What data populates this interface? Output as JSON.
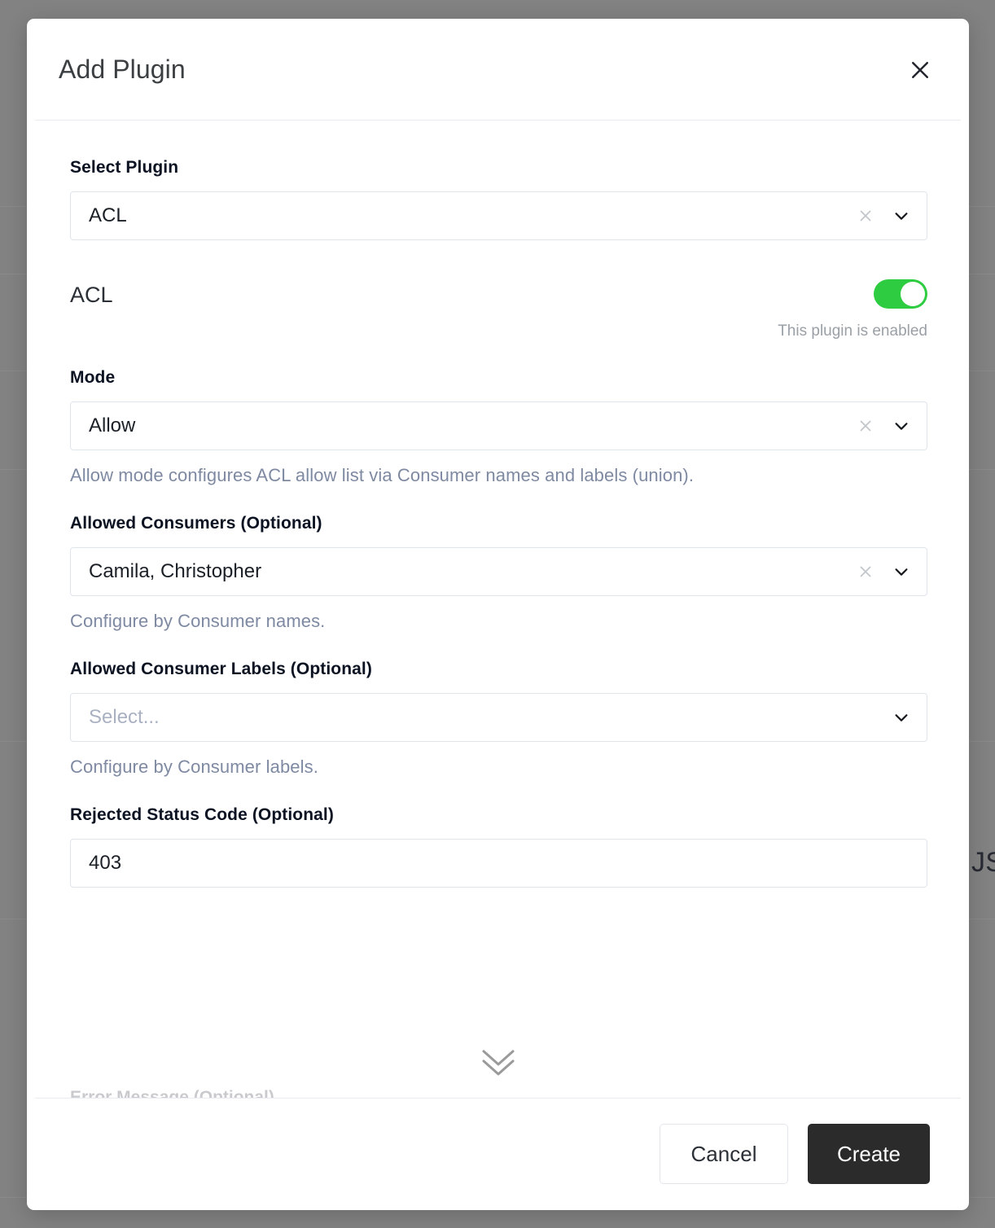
{
  "background": {
    "visible_text": "JS",
    "overlay_color": "#828282"
  },
  "modal": {
    "title": "Add Plugin",
    "close_icon": "close-icon",
    "fields": {
      "select_plugin": {
        "label": "Select Plugin",
        "value": "ACL",
        "clear_icon": "clear-x-icon",
        "chevron_icon": "chevron-down-icon"
      },
      "plugin_toggle": {
        "name": "ACL",
        "enabled": true,
        "caption": "This plugin is enabled",
        "on_color": "#2ecc40"
      },
      "mode": {
        "label": "Mode",
        "value": "Allow",
        "help": "Allow mode configures ACL allow list via Consumer names and labels (union).",
        "clear_icon": "clear-x-icon",
        "chevron_icon": "chevron-down-icon"
      },
      "allowed_consumers": {
        "label": "Allowed Consumers (Optional)",
        "value": "Camila, Christopher",
        "help": "Configure by Consumer names.",
        "clear_icon": "clear-x-icon",
        "chevron_icon": "chevron-down-icon"
      },
      "allowed_consumer_labels": {
        "label": "Allowed Consumer Labels (Optional)",
        "value": "",
        "placeholder": "Select...",
        "help": "Configure by Consumer labels.",
        "chevron_icon": "chevron-down-icon"
      },
      "rejected_status_code": {
        "label": "Rejected Status Code (Optional)",
        "value": "403"
      },
      "next_field_clipped": {
        "label": "Error Message (Optional)"
      }
    },
    "scroll_indicator": "double-chevron-down-icon",
    "footer": {
      "cancel_label": "Cancel",
      "create_label": "Create"
    }
  }
}
